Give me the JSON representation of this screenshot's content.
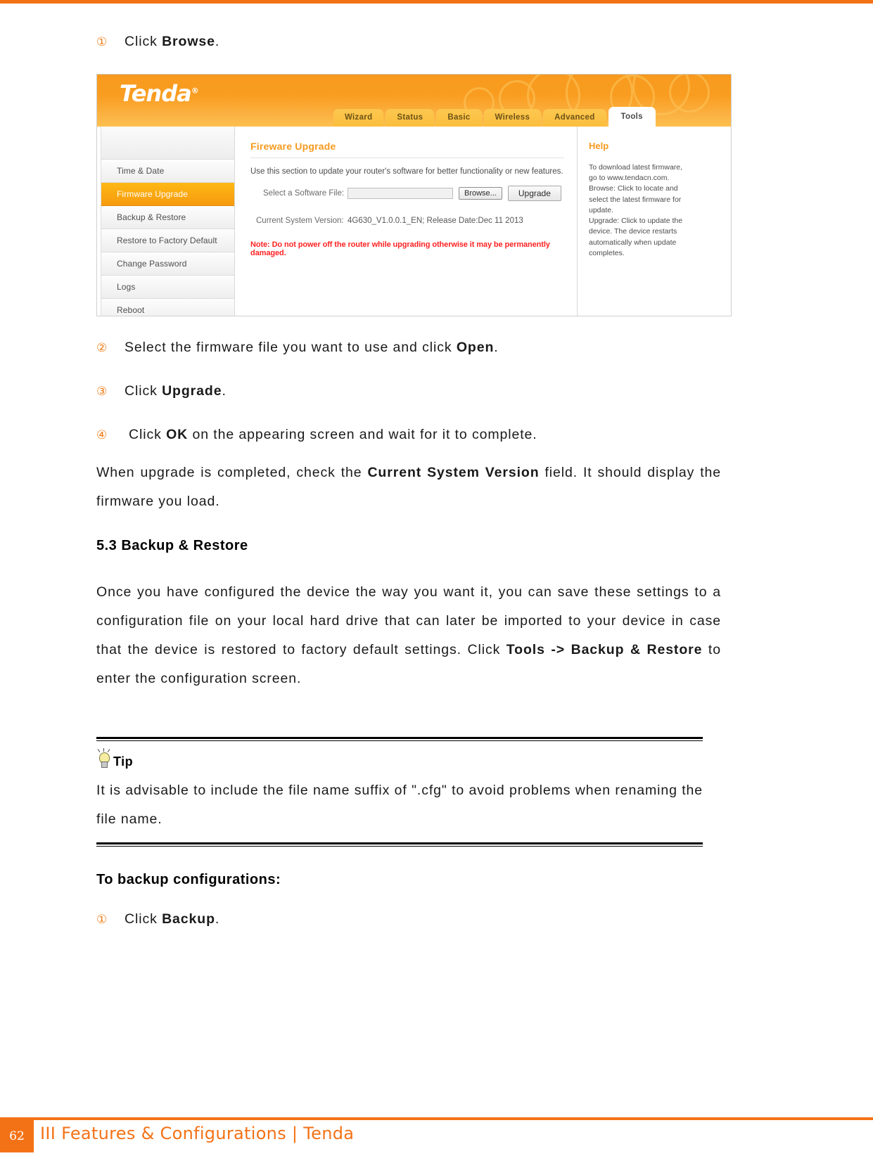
{
  "page": {
    "number": "62",
    "footer_text": "III Features & Configurations | Tenda",
    "accent": "#f47216"
  },
  "steps": {
    "s1": {
      "marker": "①",
      "pre": "Click ",
      "bold": "Browse",
      "post": "."
    },
    "s2": {
      "marker": "②",
      "pre": "Select the firmware file you want to use and click ",
      "bold": "Open",
      "post": "."
    },
    "s3": {
      "marker": "③",
      "pre": "Click ",
      "bold": "Upgrade",
      "post": "."
    },
    "s4": {
      "marker": "④",
      "pre": "Click ",
      "bold": "OK",
      "post": " on the appearing screen and wait for it to complete."
    },
    "s5": {
      "marker": "①",
      "pre": "Click ",
      "bold": "Backup",
      "post": "."
    }
  },
  "body": {
    "after_steps_pre": "When upgrade is completed, check the ",
    "after_steps_bold": "Current System Version",
    "after_steps_post": " field. It should display the firmware you load.",
    "section_heading": "5.3 Backup & Restore",
    "section_para_pre": "Once you have configured the device the way you want it, you can save these settings to a configuration file on your local hard drive that can later be imported to your device in case that the device is restored to factory default settings. Click ",
    "section_para_bold": "Tools -> Backup & Restore",
    "section_para_post": " to enter the configuration screen.",
    "backup_heading": "To backup configurations:"
  },
  "tip": {
    "label": "Tip",
    "icon": "lightbulb-icon",
    "text": "It is advisable to include the file name suffix of \".cfg\" to avoid problems when renaming the file name."
  },
  "router": {
    "brand": "Tenda",
    "brand_mark": "®",
    "tabs": [
      {
        "label": "Wizard",
        "active": false
      },
      {
        "label": "Status",
        "active": false
      },
      {
        "label": "Basic",
        "active": false
      },
      {
        "label": "Wireless",
        "active": false
      },
      {
        "label": "Advanced",
        "active": false
      },
      {
        "label": "Tools",
        "active": true
      }
    ],
    "sidebar": [
      {
        "label": "Time & Date",
        "active": false
      },
      {
        "label": "Firmware Upgrade",
        "active": true
      },
      {
        "label": "Backup & Restore",
        "active": false
      },
      {
        "label": "Restore to Factory Default",
        "active": false
      },
      {
        "label": "Change Password",
        "active": false
      },
      {
        "label": "Logs",
        "active": false
      },
      {
        "label": "Reboot",
        "active": false
      }
    ],
    "main": {
      "title": "Fireware Upgrade",
      "description": "Use this section to update your router's software for better functionality or new features.",
      "file_label": "Select a Software File:",
      "file_value": "",
      "browse_button": "Browse...",
      "upgrade_button": "Upgrade",
      "version_label": "Current System Version:",
      "version_value": "4G630_V1.0.0.1_EN; Release Date:Dec 11 2013",
      "note": "Note: Do not power off the router while upgrading otherwise it may be permanently damaged."
    },
    "help": {
      "title": "Help",
      "lines": [
        "To download latest firmware,",
        "go to www.tendacn.com.",
        "Browse: Click to locate and",
        "select the latest firmware for",
        "update.",
        "Upgrade: Click to update the",
        "device. The device restarts",
        "automatically when update",
        "completes."
      ]
    }
  }
}
